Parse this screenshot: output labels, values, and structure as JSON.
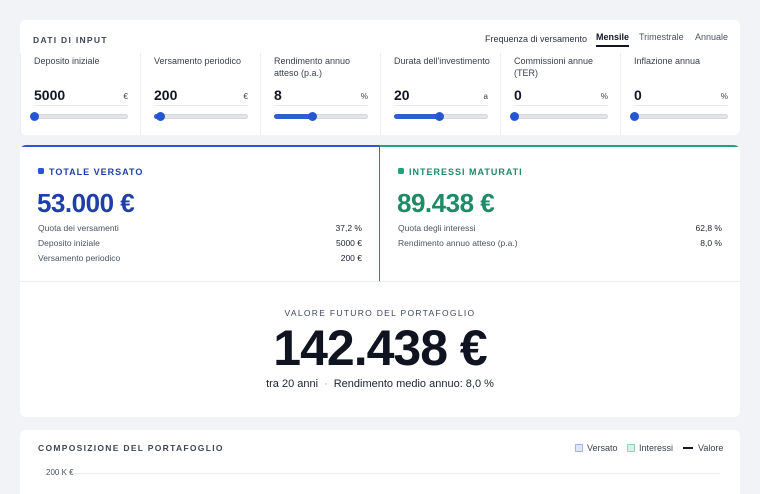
{
  "input": {
    "title": "DATI DI INPUT",
    "frequency": {
      "label": "Frequenza di versamento",
      "options": [
        "Mensile",
        "Trimestrale",
        "Annuale"
      ],
      "selected": "Mensile"
    },
    "fields": [
      {
        "label": "Deposito iniziale",
        "value": "5000",
        "unit": "€",
        "slider": 0.0
      },
      {
        "label": "Versamento periodico",
        "value": "200",
        "unit": "€",
        "slider": 0.06
      },
      {
        "label": "Rendimento annuo atteso (p.a.)",
        "value": "8",
        "unit": "%",
        "slider": 0.4
      },
      {
        "label": "Durata dell'investimento",
        "value": "20",
        "unit": "a",
        "slider": 0.48
      },
      {
        "label": "Commissioni annue (TER)",
        "value": "0",
        "unit": "%",
        "slider": 0.0
      },
      {
        "label": "Inflazione annua",
        "value": "0",
        "unit": "%",
        "slider": 0.0
      }
    ]
  },
  "results": {
    "versato": {
      "title": "TOTALE VERSATO",
      "value": "53.000 €",
      "rows": [
        {
          "label": "Quota dei versamenti",
          "value": "37,2 %"
        },
        {
          "label": "Deposito iniziale",
          "value": "5000 €"
        },
        {
          "label": "Versamento periodico",
          "value": "200 €"
        }
      ]
    },
    "interessi": {
      "title": "INTERESSI MATURATI",
      "value": "89.438 €",
      "rows": [
        {
          "label": "Quota degli interessi",
          "value": "62,8 %"
        },
        {
          "label": "Rendimento annuo atteso (p.a.)",
          "value": "8,0 %"
        }
      ]
    },
    "future": {
      "title": "VALORE FUTURO DEL PORTAFOGLIO",
      "value": "142.438 €",
      "years": "tra 20 anni",
      "separator": "·",
      "avg": "Rendimento medio annuo: 8,0 %"
    }
  },
  "composition": {
    "title": "COMPOSIZIONE DEL PORTAFOGLIO",
    "legend": [
      "Versato",
      "Interessi",
      "Valore"
    ],
    "tick": "200 K €"
  },
  "colors": {
    "blue": "#2457cf",
    "blue_text": "#1f3fa8",
    "green": "#1f8a66",
    "dark": "#111725"
  }
}
